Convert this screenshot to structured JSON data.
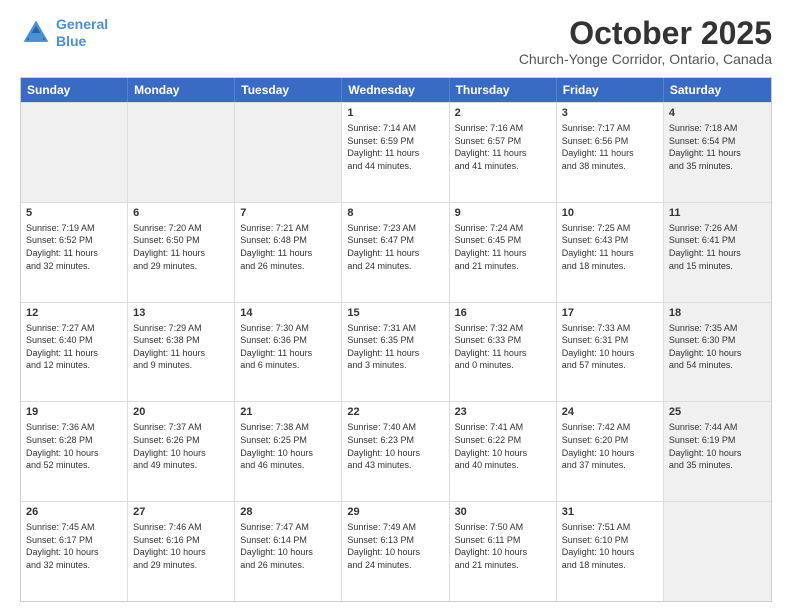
{
  "header": {
    "logo_line1": "General",
    "logo_line2": "Blue",
    "month": "October 2025",
    "location": "Church-Yonge Corridor, Ontario, Canada"
  },
  "weekdays": [
    "Sunday",
    "Monday",
    "Tuesday",
    "Wednesday",
    "Thursday",
    "Friday",
    "Saturday"
  ],
  "rows": [
    [
      {
        "day": "",
        "text": "",
        "shaded": true
      },
      {
        "day": "",
        "text": "",
        "shaded": true
      },
      {
        "day": "",
        "text": "",
        "shaded": true
      },
      {
        "day": "1",
        "text": "Sunrise: 7:14 AM\nSunset: 6:59 PM\nDaylight: 11 hours\nand 44 minutes."
      },
      {
        "day": "2",
        "text": "Sunrise: 7:16 AM\nSunset: 6:57 PM\nDaylight: 11 hours\nand 41 minutes."
      },
      {
        "day": "3",
        "text": "Sunrise: 7:17 AM\nSunset: 6:56 PM\nDaylight: 11 hours\nand 38 minutes."
      },
      {
        "day": "4",
        "text": "Sunrise: 7:18 AM\nSunset: 6:54 PM\nDaylight: 11 hours\nand 35 minutes.",
        "shaded": true
      }
    ],
    [
      {
        "day": "5",
        "text": "Sunrise: 7:19 AM\nSunset: 6:52 PM\nDaylight: 11 hours\nand 32 minutes."
      },
      {
        "day": "6",
        "text": "Sunrise: 7:20 AM\nSunset: 6:50 PM\nDaylight: 11 hours\nand 29 minutes."
      },
      {
        "day": "7",
        "text": "Sunrise: 7:21 AM\nSunset: 6:48 PM\nDaylight: 11 hours\nand 26 minutes."
      },
      {
        "day": "8",
        "text": "Sunrise: 7:23 AM\nSunset: 6:47 PM\nDaylight: 11 hours\nand 24 minutes."
      },
      {
        "day": "9",
        "text": "Sunrise: 7:24 AM\nSunset: 6:45 PM\nDaylight: 11 hours\nand 21 minutes."
      },
      {
        "day": "10",
        "text": "Sunrise: 7:25 AM\nSunset: 6:43 PM\nDaylight: 11 hours\nand 18 minutes."
      },
      {
        "day": "11",
        "text": "Sunrise: 7:26 AM\nSunset: 6:41 PM\nDaylight: 11 hours\nand 15 minutes.",
        "shaded": true
      }
    ],
    [
      {
        "day": "12",
        "text": "Sunrise: 7:27 AM\nSunset: 6:40 PM\nDaylight: 11 hours\nand 12 minutes."
      },
      {
        "day": "13",
        "text": "Sunrise: 7:29 AM\nSunset: 6:38 PM\nDaylight: 11 hours\nand 9 minutes."
      },
      {
        "day": "14",
        "text": "Sunrise: 7:30 AM\nSunset: 6:36 PM\nDaylight: 11 hours\nand 6 minutes."
      },
      {
        "day": "15",
        "text": "Sunrise: 7:31 AM\nSunset: 6:35 PM\nDaylight: 11 hours\nand 3 minutes."
      },
      {
        "day": "16",
        "text": "Sunrise: 7:32 AM\nSunset: 6:33 PM\nDaylight: 11 hours\nand 0 minutes."
      },
      {
        "day": "17",
        "text": "Sunrise: 7:33 AM\nSunset: 6:31 PM\nDaylight: 10 hours\nand 57 minutes."
      },
      {
        "day": "18",
        "text": "Sunrise: 7:35 AM\nSunset: 6:30 PM\nDaylight: 10 hours\nand 54 minutes.",
        "shaded": true
      }
    ],
    [
      {
        "day": "19",
        "text": "Sunrise: 7:36 AM\nSunset: 6:28 PM\nDaylight: 10 hours\nand 52 minutes."
      },
      {
        "day": "20",
        "text": "Sunrise: 7:37 AM\nSunset: 6:26 PM\nDaylight: 10 hours\nand 49 minutes."
      },
      {
        "day": "21",
        "text": "Sunrise: 7:38 AM\nSunset: 6:25 PM\nDaylight: 10 hours\nand 46 minutes."
      },
      {
        "day": "22",
        "text": "Sunrise: 7:40 AM\nSunset: 6:23 PM\nDaylight: 10 hours\nand 43 minutes."
      },
      {
        "day": "23",
        "text": "Sunrise: 7:41 AM\nSunset: 6:22 PM\nDaylight: 10 hours\nand 40 minutes."
      },
      {
        "day": "24",
        "text": "Sunrise: 7:42 AM\nSunset: 6:20 PM\nDaylight: 10 hours\nand 37 minutes."
      },
      {
        "day": "25",
        "text": "Sunrise: 7:44 AM\nSunset: 6:19 PM\nDaylight: 10 hours\nand 35 minutes.",
        "shaded": true
      }
    ],
    [
      {
        "day": "26",
        "text": "Sunrise: 7:45 AM\nSunset: 6:17 PM\nDaylight: 10 hours\nand 32 minutes."
      },
      {
        "day": "27",
        "text": "Sunrise: 7:46 AM\nSunset: 6:16 PM\nDaylight: 10 hours\nand 29 minutes."
      },
      {
        "day": "28",
        "text": "Sunrise: 7:47 AM\nSunset: 6:14 PM\nDaylight: 10 hours\nand 26 minutes."
      },
      {
        "day": "29",
        "text": "Sunrise: 7:49 AM\nSunset: 6:13 PM\nDaylight: 10 hours\nand 24 minutes."
      },
      {
        "day": "30",
        "text": "Sunrise: 7:50 AM\nSunset: 6:11 PM\nDaylight: 10 hours\nand 21 minutes."
      },
      {
        "day": "31",
        "text": "Sunrise: 7:51 AM\nSunset: 6:10 PM\nDaylight: 10 hours\nand 18 minutes."
      },
      {
        "day": "",
        "text": "",
        "shaded": true
      }
    ]
  ]
}
